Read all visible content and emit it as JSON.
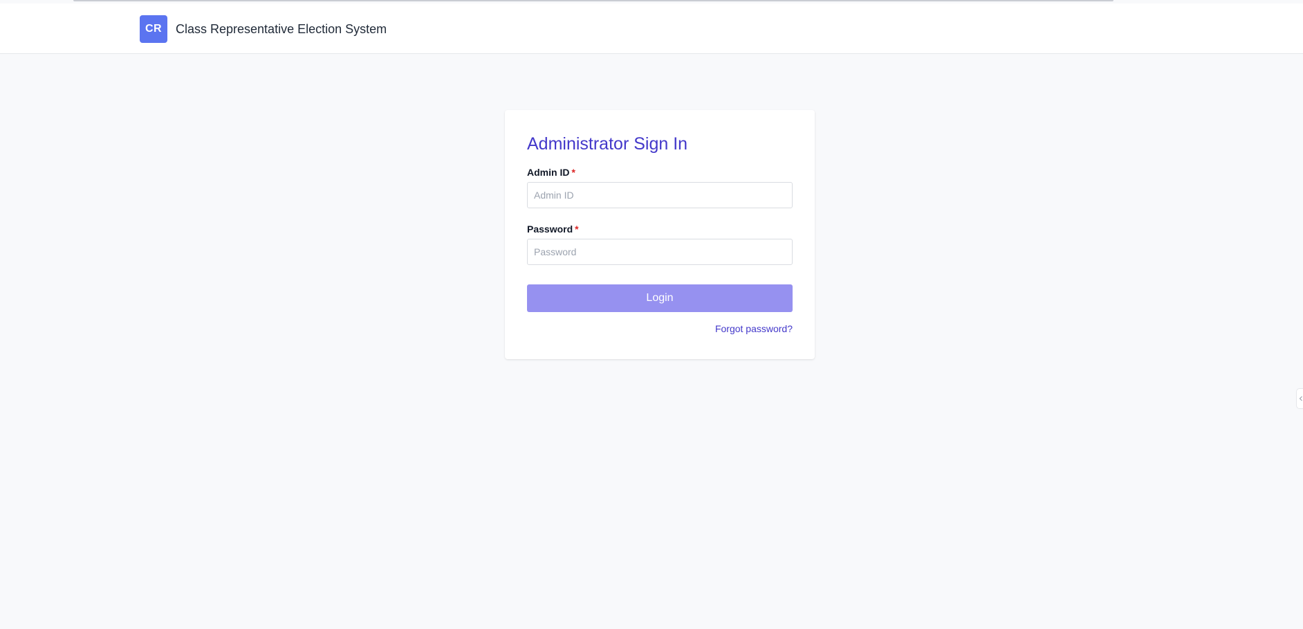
{
  "header": {
    "logo_text": "CR",
    "title": "Class Representative Election System"
  },
  "login_card": {
    "title": "Administrator Sign In",
    "admin_id": {
      "label": "Admin ID",
      "required_mark": "*",
      "placeholder": "Admin ID",
      "value": ""
    },
    "password": {
      "label": "Password",
      "required_mark": "*",
      "placeholder": "Password",
      "value": ""
    },
    "login_button_label": "Login",
    "forgot_password_label": "Forgot password?"
  },
  "colors": {
    "logo_bg": "#5b74f0",
    "title_text": "#4338ca",
    "button_bg": "#9691f0",
    "link_text": "#4338ca",
    "required_mark": "#dc2626",
    "page_bg": "#f8f9fb"
  },
  "icons": {
    "edge_tab": "chevron-left-icon"
  }
}
